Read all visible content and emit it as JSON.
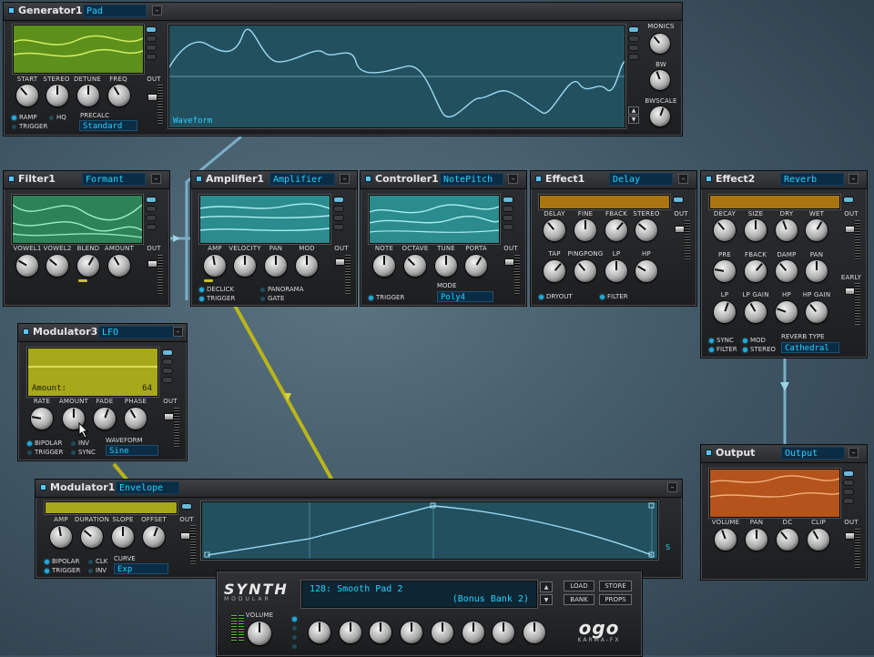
{
  "colors": {
    "accent": "#26d3ff",
    "wire_blue": "#7fb8d0",
    "wire_yellow": "#b9b51a",
    "teal_screen": "#2b8a8c",
    "green_screen": "#5a8a1c",
    "orange_screen": "#b5521b"
  },
  "generator": {
    "title": "Generator1",
    "preset": "Pad",
    "knobs": [
      "START",
      "STEREO",
      "DETUNE",
      "FREQ"
    ],
    "out_label": "OUT",
    "checks": {
      "ramp": "RAMP",
      "hq": "HQ",
      "trigger": "TRIGGER"
    },
    "precalc_label": "PRECALC",
    "precalc_value": "Standard",
    "waveform_label": "Waveform",
    "right_knobs": [
      "MONICS",
      "BW",
      "BWSCALE"
    ]
  },
  "filter": {
    "title": "Filter1",
    "preset": "Formant",
    "knobs": [
      "VOWEL1",
      "VOWEL2",
      "BLEND",
      "AMOUNT"
    ],
    "out_label": "OUT"
  },
  "amplifier": {
    "title": "Amplifier1",
    "preset": "Amplifier",
    "knobs": [
      "AMP",
      "VELOCITY",
      "PAN",
      "MOD"
    ],
    "out_label": "OUT",
    "checks": {
      "declick": "DECLICK",
      "panorama": "PANORAMA",
      "trigger": "TRIGGER",
      "gate": "GATE"
    }
  },
  "controller": {
    "title": "Controller1",
    "preset": "NotePitch",
    "knobs": [
      "NOTE",
      "OCTAVE",
      "TUNE",
      "PORTA"
    ],
    "out_label": "OUT",
    "trigger": "TRIGGER",
    "mode_label": "MODE",
    "mode_value": "Poly4"
  },
  "effect1": {
    "title": "Effect1",
    "preset": "Delay",
    "knobs_row1": [
      "DELAY",
      "FINE",
      "FBACK",
      "STEREO"
    ],
    "knobs_row2": [
      "TAP",
      "PINGPONG",
      "LP",
      "HP"
    ],
    "out_label": "OUT",
    "checks": {
      "dryout": "DRYOUT",
      "filter": "FILTER"
    }
  },
  "effect2": {
    "title": "Effect2",
    "preset": "Reverb",
    "knobs_row1": [
      "DECAY",
      "SIZE",
      "DRY",
      "WET"
    ],
    "knobs_row2": [
      "PRE",
      "FBACK",
      "DAMP",
      "PAN"
    ],
    "knobs_row3": [
      "LP",
      "LP GAIN",
      "HP",
      "HP GAIN"
    ],
    "out_label": "OUT",
    "early_label": "EARLY",
    "checks": {
      "sync": "SYNC",
      "mod": "MOD",
      "filter": "FILTER",
      "stereo": "STEREO"
    },
    "reverb_type_label": "REVERB TYPE",
    "reverb_type_value": "Cathedral"
  },
  "modulator3": {
    "title": "Modulator3",
    "preset": "LFO",
    "screen_label": "Amount:",
    "screen_value": "64",
    "knobs": [
      "RATE",
      "AMOUNT",
      "FADE",
      "PHASE"
    ],
    "out_label": "OUT",
    "checks": {
      "bipolar": "BIPOLAR",
      "inv": "INV",
      "trigger": "TRIGGER",
      "sync": "SYNC"
    },
    "waveform_label": "WAVEFORM",
    "waveform_value": "Sine"
  },
  "modulator1": {
    "title": "Modulator1",
    "preset": "Envelope",
    "knobs": [
      "AMP",
      "DURATION",
      "SLOPE",
      "OFFSET"
    ],
    "out_label": "OUT",
    "checks": {
      "bipolar": "BIPOLAR",
      "clk": "CLK",
      "trigger": "TRIGGER",
      "inv": "INV"
    },
    "curve_label": "CURVE",
    "curve_value": "Exp",
    "s_label": "S"
  },
  "output": {
    "title": "Output",
    "preset": "Output",
    "knobs": [
      "VOLUME",
      "PAN",
      "DC",
      "CLIP"
    ],
    "out_label": "OUT"
  },
  "main": {
    "logo": "SYNTH",
    "logo_sub": "MODULAR",
    "preset_name": "128: Smooth Pad 2",
    "bank_name": "(Bonus Bank 2)",
    "buttons": {
      "load": "LOAD",
      "store": "STORE",
      "bank": "BANK",
      "props": "PROPS"
    },
    "volume_label": "VOLUME",
    "brand": "ogo",
    "brand_sub": "KARMA-FX"
  }
}
